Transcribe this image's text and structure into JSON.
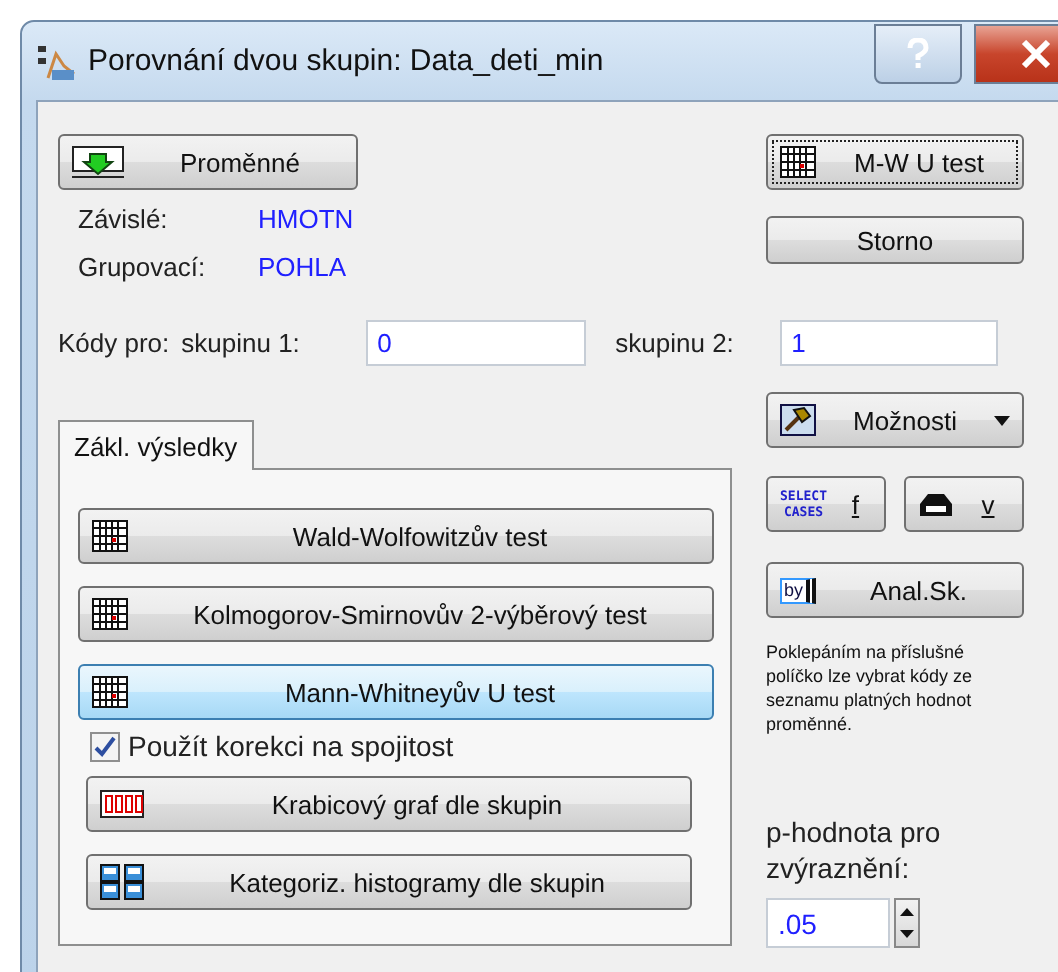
{
  "window": {
    "title": "Porovnání dvou skupin: Data_deti_min"
  },
  "variables_button": "Proměnné",
  "dependent": {
    "label": "Závislé:",
    "value": "HMOTN"
  },
  "grouping": {
    "label": "Grupovací:",
    "value": "POHLA"
  },
  "codes": {
    "label": "Kódy pro:",
    "group1_label": "skupinu 1:",
    "group1_value": "0",
    "group2_label": "skupinu 2:",
    "group2_value": "1"
  },
  "tabs": [
    {
      "label": "Zákl. výsledky",
      "selected": true
    }
  ],
  "test_buttons": [
    {
      "label": "Wald-Wolfowitzův test",
      "selected": false
    },
    {
      "label": "Kolmogorov-Smirnovův 2-výběrový test",
      "selected": false
    },
    {
      "label": "Mann-Whitneyův U test",
      "selected": true
    }
  ],
  "continuity_correction": {
    "label": "Použít korekci na spojitost",
    "checked": true
  },
  "plot_buttons": [
    {
      "label": "Krabicový graf dle skupin",
      "kind": "boxplot"
    },
    {
      "label": "Kategoriz. histogramy dle skupin",
      "kind": "histogram"
    }
  ],
  "side_buttons": {
    "ok": "M-W U test",
    "cancel": "Storno",
    "options": "Možnosti",
    "select_cases": "f",
    "weights": "v",
    "by_group": "Anal.Sk."
  },
  "select_cases_icon": [
    "SELECT",
    "CASES"
  ],
  "by_group_icon": "by",
  "hint": "Poklepáním na příslušné políčko lze vybrat kódy ze seznamu platných hodnot proměnné.",
  "p_value": {
    "label": "p-hodnota pro zvýraznění:",
    "value": ".05"
  }
}
